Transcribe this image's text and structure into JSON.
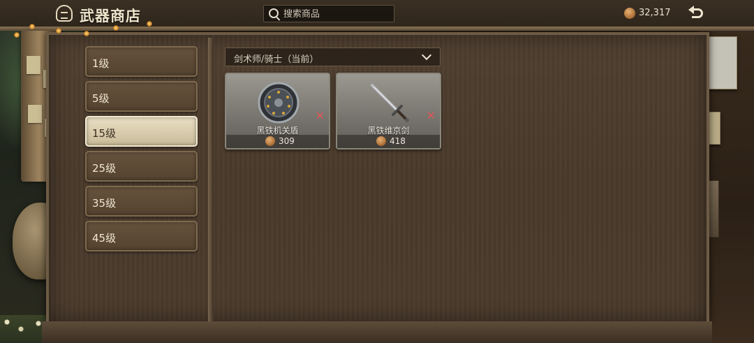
{
  "header": {
    "title": "武器商店",
    "search_placeholder": "搜索商品",
    "gold": "32,317"
  },
  "levels": [
    {
      "label": "1级",
      "active": false
    },
    {
      "label": "5级",
      "active": false
    },
    {
      "label": "15级",
      "active": true
    },
    {
      "label": "25级",
      "active": false
    },
    {
      "label": "35级",
      "active": false
    },
    {
      "label": "45级",
      "active": false
    }
  ],
  "class_filter": {
    "selected": "剑术师/骑士（当前）"
  },
  "items": [
    {
      "name": "黑铁机关盾",
      "price": "309",
      "icon": "shield-icon",
      "unusable_mark": "✕"
    },
    {
      "name": "黑铁维京剑",
      "price": "418",
      "icon": "sword-icon",
      "unusable_mark": "✕"
    }
  ],
  "colors": {
    "unusable_mark": "#e0555a",
    "active_tab": "#e9dfc4"
  }
}
